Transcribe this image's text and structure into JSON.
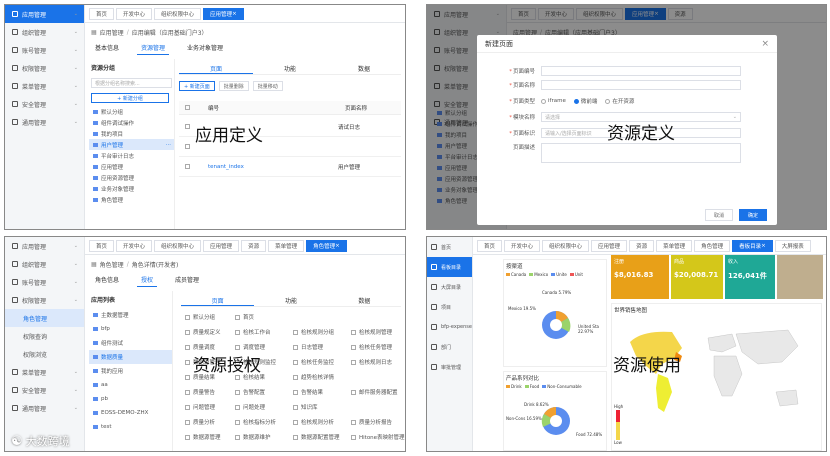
{
  "pane1": {
    "sidebar": [
      {
        "label": "应用管理",
        "active": true
      },
      {
        "label": "组织管理"
      },
      {
        "label": "账号管理"
      },
      {
        "label": "权限管理"
      },
      {
        "label": "菜单管理"
      },
      {
        "label": "安全管理"
      },
      {
        "label": "通用管理"
      }
    ],
    "tabs": [
      "首页",
      "开发中心",
      "组织权限中心",
      "应用管理"
    ],
    "active_tab": "应用管理",
    "breadcrumb": [
      "应用管理",
      "应用编辑（应用基础门户3）"
    ],
    "subtabs": [
      "基本信息",
      "资源管理",
      "业务对象管理"
    ],
    "active_subtab": "资源管理",
    "tree_title": "资源分组",
    "search_placeholder": "根据分组名称搜索...",
    "new_group_label": "+ 新建分组",
    "tree_items": [
      "默认分组",
      "组件调试操作",
      "我的项目",
      "用户管理",
      "平台审计日志",
      "应用管理",
      "应用资源管理",
      "业务对象管理",
      "角色管理"
    ],
    "selected_tree_item": "用户管理",
    "res_tabs": [
      "页面",
      "功能",
      "数据"
    ],
    "toolbar": [
      "+ 新建页面",
      "批量删除",
      "批量移动"
    ],
    "table_headers": [
      "编号",
      "页面名称"
    ],
    "rows": [
      [
        "",
        "请试日志"
      ],
      [
        "",
        ""
      ],
      [
        "tenant_index",
        "用户管理"
      ]
    ],
    "caption": "应用定义"
  },
  "pane2": {
    "sidebar": [
      "应用管理",
      "组织管理",
      "账号管理",
      "权限管理",
      "菜单管理",
      "安全管理",
      "通用管理"
    ],
    "tabs": [
      "首页",
      "开发中心",
      "组织权限中心",
      "应用管理",
      "资源"
    ],
    "breadcrumb": [
      "应用管理",
      "应用编辑（应用基础门户3）"
    ],
    "modal_title": "新建页面",
    "close_glyph": "×",
    "fields": [
      {
        "label": "页面编号",
        "required": true
      },
      {
        "label": "页面名称",
        "required": true
      },
      {
        "label": "页面类型",
        "required": true
      },
      {
        "label": "模块名称",
        "required": true
      },
      {
        "label": "页面标识",
        "required": true
      },
      {
        "label": "页面描述",
        "required": false
      }
    ],
    "radio_options": [
      "iframe",
      "微前端",
      "在开资源"
    ],
    "radio_selected": "微前端",
    "module_placeholder": "请选择",
    "identifier_placeholder": "请输入/选择页面标识",
    "cancel_label": "取消",
    "confirm_label": "确定",
    "bg_tree_items": [
      "默认分组",
      "组件调试操作",
      "我的项目",
      "用户管理",
      "平台审计日志",
      "应用管理",
      "应用资源管理",
      "业务对象管理",
      "角色管理"
    ],
    "caption": "资源定义"
  },
  "pane3": {
    "sidebar": [
      {
        "label": "应用管理"
      },
      {
        "label": "组织管理"
      },
      {
        "label": "账号管理"
      },
      {
        "label": "权限管理"
      },
      {
        "label": "角色管理",
        "sub": true,
        "active": true
      },
      {
        "label": "权限查询",
        "sub": true
      },
      {
        "label": "权限浏览",
        "sub": true
      },
      {
        "label": "菜单管理"
      },
      {
        "label": "安全管理"
      },
      {
        "label": "通用管理"
      }
    ],
    "tabs": [
      "首页",
      "开发中心",
      "组织权限中心",
      "应用管理",
      "资源",
      "菜单管理",
      "角色管理"
    ],
    "active_tab": "角色管理",
    "breadcrumb": [
      "角色管理",
      "角色详情(开发者)"
    ],
    "subtabs": [
      "角色信息",
      "授权",
      "成员管理"
    ],
    "active_subtab": "授权",
    "app_list_title": "应用列表",
    "apps": [
      "主数据管理",
      "bfp",
      "组件测试",
      "数据质量",
      "我的应用",
      "aa",
      "pb",
      "EOSS-DEMO-ZHX",
      "test"
    ],
    "selected_app": "数据质量",
    "res_tabs": [
      "页面",
      "功能",
      "数据"
    ],
    "perm_rows": [
      [
        "默认分组",
        "首页"
      ],
      [
        "质量规定义",
        "检核工作台",
        "检核规则分组",
        "检核规则管理"
      ],
      [
        "质量调度",
        "调度管理",
        "日志管理",
        "检核任务管理"
      ],
      [
        "数据源管理",
        "检核规则监控",
        "检核任务监控",
        "检核规则日志"
      ],
      [
        "质量结果",
        "检核结果",
        "趋势检核详情"
      ],
      [
        "质量警告",
        "告警配置",
        "告警结果",
        "邮件服务器配置"
      ],
      [
        "问题管理",
        "问题处理",
        "知识库"
      ],
      [
        "质量分析",
        "检核指标分析",
        "检核规则分析",
        "质量分析报告"
      ],
      [
        "数据源管理",
        "数据源维护",
        "数据源配置管理",
        "Hitone表映射管理"
      ]
    ],
    "watermark": "大数跨境",
    "caption": "资源授权"
  },
  "pane4": {
    "sidebar": [
      {
        "label": "首页"
      },
      {
        "label": "看板目录",
        "active": true
      },
      {
        "label": "大屏目录"
      },
      {
        "label": "项目"
      },
      {
        "label": "bfp-expense"
      },
      {
        "label": "部门"
      },
      {
        "label": "审批管理"
      }
    ],
    "tabs": [
      "首页",
      "开发中心",
      "组织权限中心",
      "应用管理",
      "资源",
      "菜单管理",
      "角色管理",
      "看板目录",
      "大屏报表"
    ],
    "active_tab": "看板目录",
    "cards": [
      {
        "title": "注册",
        "value": "$8,016.83",
        "color": "#e8a018"
      },
      {
        "title": "商品",
        "value": "$20,008.71",
        "color": "#d4c71a"
      },
      {
        "title": "收入",
        "value": "126,041件",
        "color": "#1fa896"
      },
      {
        "title": "",
        "value": "",
        "color": "#bfae8e"
      }
    ],
    "chart1": {
      "title": "按渠道",
      "legend": [
        "Canada",
        "Mexico",
        "Unite",
        "Unit"
      ],
      "labels": [
        "Canada 5.79%",
        "Mexico 19.5%",
        "United Sta 22.97%"
      ]
    },
    "chart2": {
      "title": "产品系列对比",
      "legend": [
        "Drink",
        "Food",
        "Non-Consumable"
      ],
      "labels": [
        "Drink 8.62%",
        "Non-Cons 16.59%",
        "Food 72.48%"
      ]
    },
    "map_title": "世界销售地图",
    "map_legend_high": "High",
    "map_legend_low": "Low",
    "caption": "资源使用"
  }
}
